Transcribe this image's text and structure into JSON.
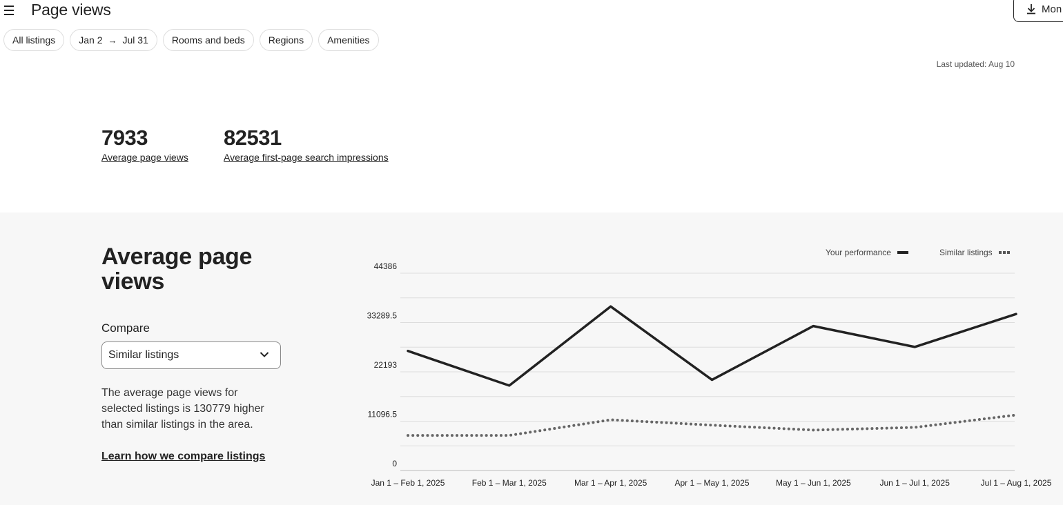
{
  "header": {
    "title": "Page views",
    "more_button_label": "Mon"
  },
  "filters": {
    "all_listings": "All listings",
    "date_start": "Jan 2",
    "date_end": "Jul 31",
    "rooms": "Rooms and beds",
    "regions": "Regions",
    "amenities": "Amenities"
  },
  "last_updated": "Last updated: Aug 10",
  "stats": [
    {
      "value": "7933",
      "label": "Average page views"
    },
    {
      "value": "82531",
      "label": "Average first-page search impressions"
    }
  ],
  "section": {
    "title": "Average page views",
    "compare_label": "Compare",
    "compare_selected": "Similar listings",
    "description": "The average page views for selected listings is 130779 higher than similar listings in the area.",
    "learn_link": "Learn how we compare listings"
  },
  "legend": {
    "yours": "Your performance",
    "similar": "Similar listings"
  },
  "chart_data": {
    "type": "line",
    "categories": [
      "Jan 1 – Feb 1, 2025",
      "Feb 1 – Mar 1, 2025",
      "Mar 1 – Apr 1, 2025",
      "Apr 1 – May 1, 2025",
      "May 1 – Jun 1, 2025",
      "Jun 1 – Jul 1, 2025",
      "Jul 1 – Aug 1, 2025"
    ],
    "y_ticks": [
      "44386",
      "33289.5",
      "22193",
      "11096.5",
      "0"
    ],
    "ylim": [
      0,
      44386
    ],
    "grid": true,
    "legend_position": "top-right",
    "series": [
      {
        "name": "Your performance",
        "style": "solid",
        "color": "#222222",
        "values": [
          26900,
          19100,
          36900,
          20400,
          32500,
          27800,
          35200
        ]
      },
      {
        "name": "Similar listings",
        "style": "dotted",
        "color": "#666666",
        "values": [
          7900,
          7900,
          11400,
          10200,
          9100,
          9700,
          12500
        ]
      }
    ]
  }
}
